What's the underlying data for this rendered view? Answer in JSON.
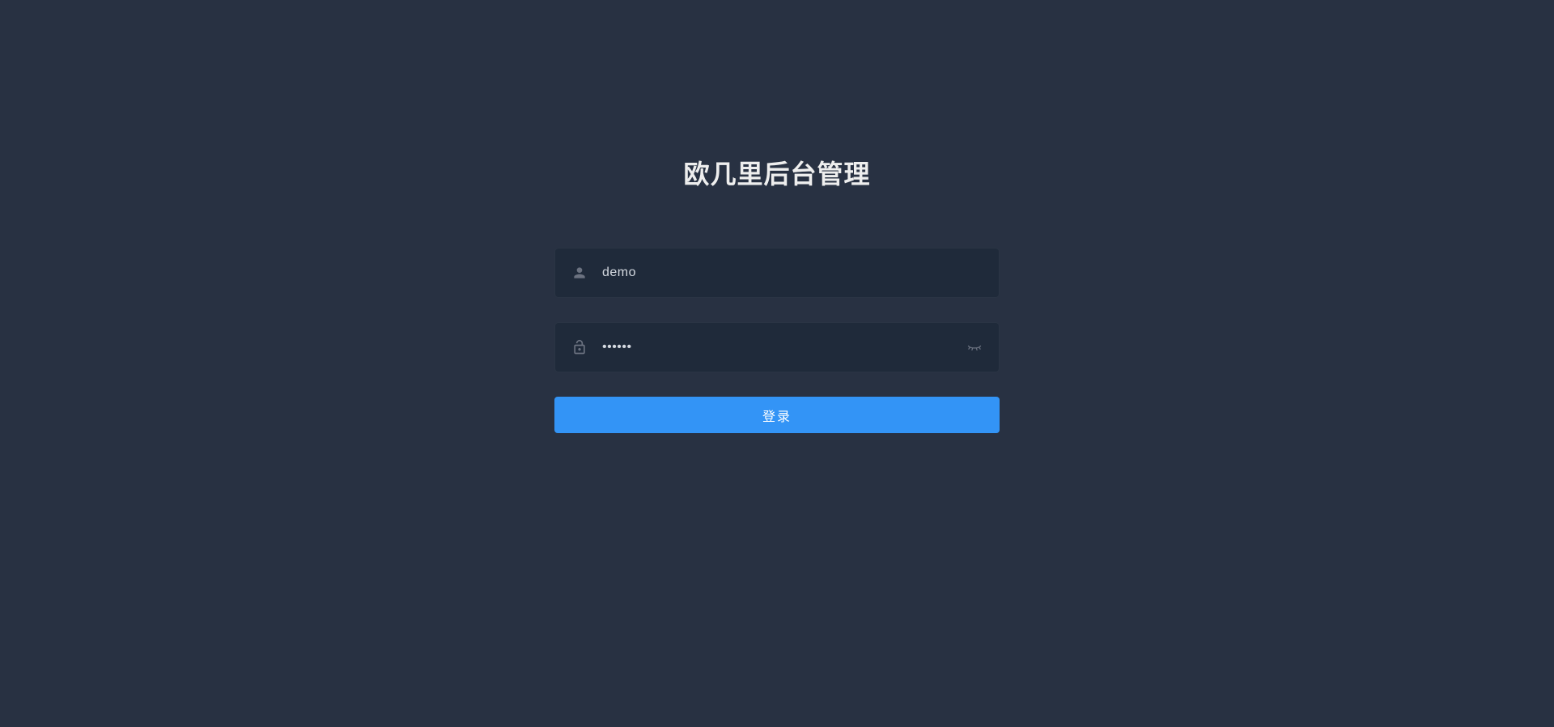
{
  "login": {
    "title": "欧几里后台管理",
    "username_value": "demo",
    "username_placeholder": "",
    "password_value": "······",
    "password_placeholder": "",
    "submit_label": "登录"
  }
}
